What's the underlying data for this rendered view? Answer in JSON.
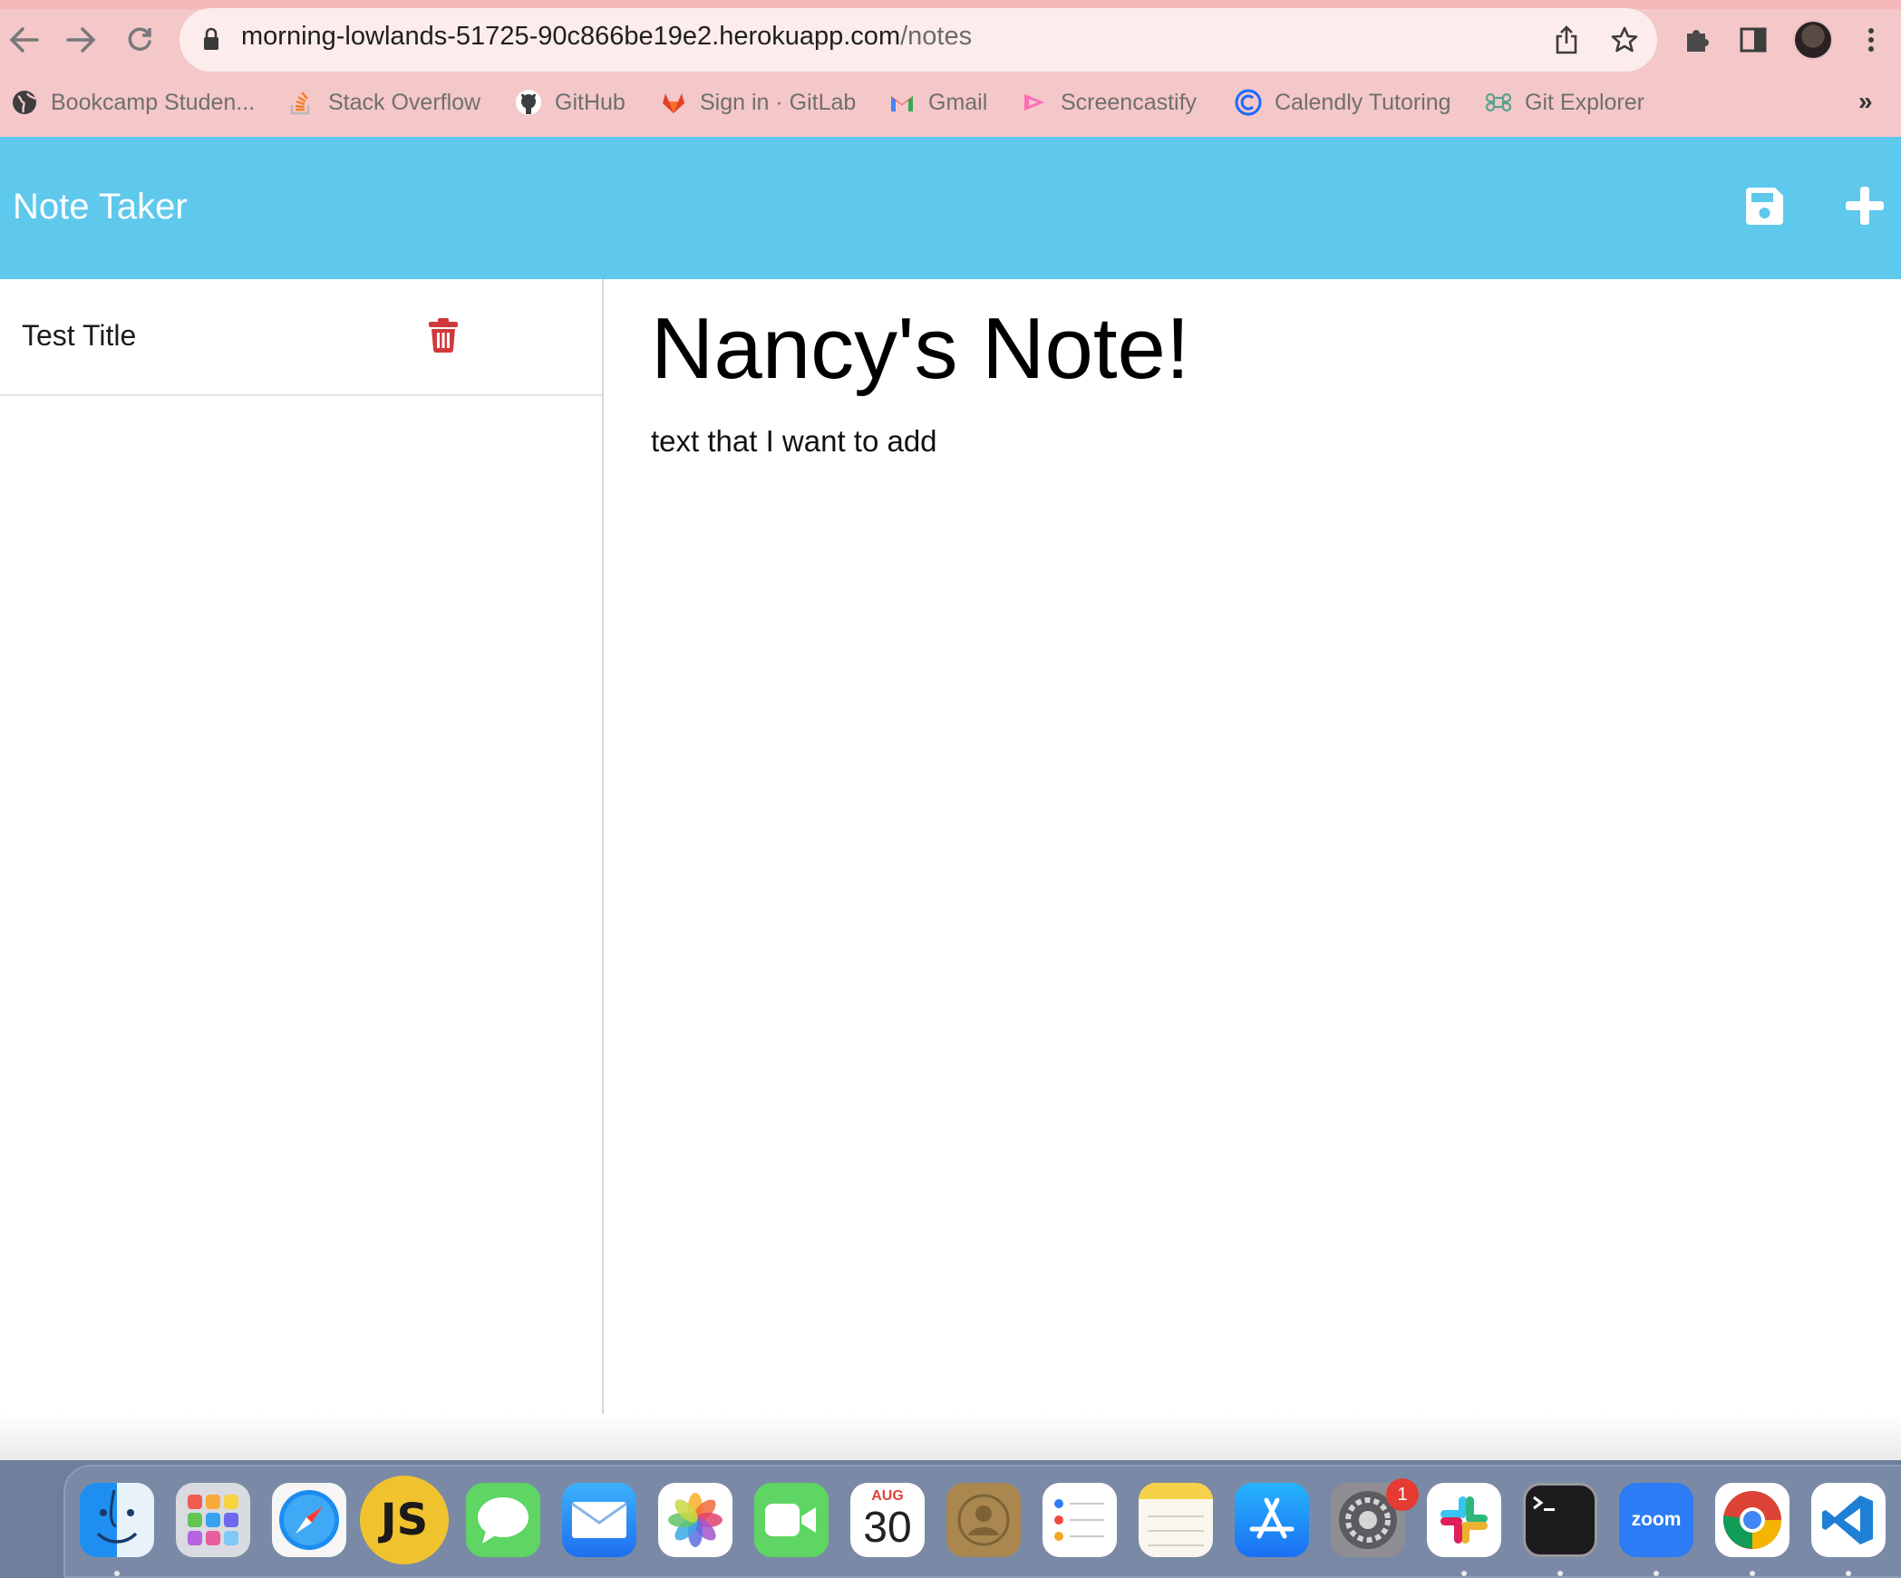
{
  "browser": {
    "url_host": "morning-lowlands-51725-90c866be19e2.herokuapp.com",
    "url_path": "/notes",
    "bookmarks": [
      {
        "label": "Bookcamp Studen...",
        "icon": "globe-icon"
      },
      {
        "label": "Stack Overflow",
        "icon": "stackoverflow-icon"
      },
      {
        "label": "GitHub",
        "icon": "github-icon"
      },
      {
        "label": "Sign in · GitLab",
        "icon": "gitlab-icon"
      },
      {
        "label": "Gmail",
        "icon": "gmail-icon"
      },
      {
        "label": "Screencastify",
        "icon": "screencastify-icon"
      },
      {
        "label": "Calendly Tutoring",
        "icon": "calendly-icon"
      },
      {
        "label": "Git Explorer",
        "icon": "command-icon"
      }
    ],
    "more_label": "»"
  },
  "app": {
    "brand": "Note Taker",
    "navbar_color": "#5ec8ed",
    "notes_list": [
      {
        "title": "Test Title"
      }
    ],
    "active_note": {
      "title": "Nancy's Note!",
      "text": "text that I want to add"
    },
    "delete_color": "#d0393b"
  },
  "dock": {
    "calendar_month": "AUG",
    "calendar_day": "30",
    "settings_badge": "1",
    "js_label": "JS",
    "zoom_label": "zoom",
    "apps": [
      "finder",
      "launchpad",
      "safari",
      "javascript",
      "messages",
      "mail",
      "photos",
      "facetime",
      "calendar",
      "contacts",
      "reminders",
      "notes",
      "app-store",
      "system-preferences",
      "slack",
      "terminal",
      "zoom",
      "chrome",
      "vscode"
    ]
  }
}
